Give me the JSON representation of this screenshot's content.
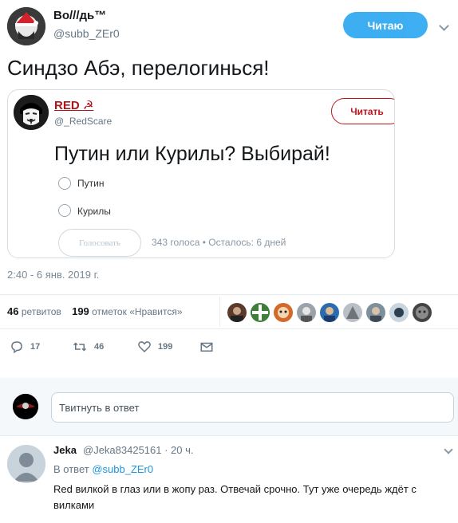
{
  "tweet": {
    "author_name": "Во///дь™",
    "author_handle": "@subb_ZEr0",
    "follow_label": "Читаю",
    "text": "Синдзо Абэ, перелогинься!",
    "timestamp": "2:40 - 6 янв. 2019 г."
  },
  "quoted": {
    "name": "RED ☭",
    "handle": "@_RedScare",
    "follow_label": "Читать",
    "poll": {
      "question": "Путин или Курилы? Выбирай!",
      "options": [
        "Путин",
        "Курилы"
      ],
      "vote_label": "Голосовать",
      "meta": "343 голоса • Осталось: 6 дней"
    }
  },
  "stats": {
    "retweets_count": "46",
    "retweets_label": "ретвитов",
    "likes_count": "199",
    "likes_label": "отметок «Нравится»"
  },
  "actions": {
    "replies": "17",
    "retweets": "46",
    "likes": "199"
  },
  "reply_box": {
    "placeholder": "Твитнуть в ответ"
  },
  "reply": {
    "name": "Jeka",
    "handle": "@Jeka83425161 · 20 ч.",
    "reply_to_prefix": "В ответ",
    "reply_to_handle": "@subb_ZEr0",
    "text": "Red вилкой в глаз или в жопу раз. Отвечай срочно. Тут уже очередь ждёт с вилками"
  },
  "colors": {
    "brand_blue": "#1da1f2",
    "quoted_red": "#c0141c"
  }
}
